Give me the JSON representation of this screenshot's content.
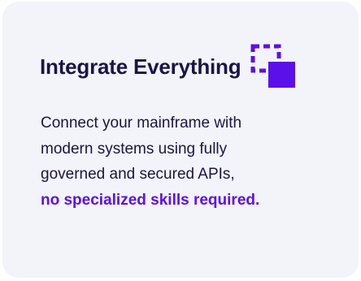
{
  "card": {
    "title": "Integrate Everything",
    "icon": "integrate-squares-icon",
    "description_lines": [
      "Connect your mainframe with",
      "modern systems using fully",
      "governed and secured APIs,"
    ],
    "emphasis": "no specialized skills required."
  },
  "colors": {
    "card_background": "#f3f4fa",
    "text": "#1b1446",
    "accent": "#5b10ea"
  }
}
